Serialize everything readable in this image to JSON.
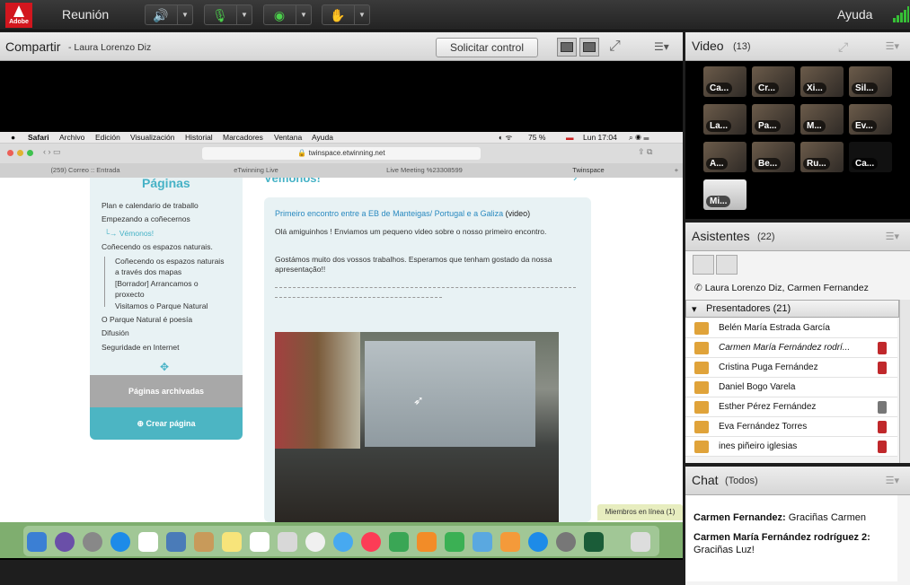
{
  "topbar": {
    "logo": "Adobe",
    "meeting_menu": "Reunión",
    "help": "Ayuda"
  },
  "share": {
    "title": "Compartir",
    "presenter": "- Laura Lorenzo Diz",
    "request_control": "Solicitar control"
  },
  "mac": {
    "app": "Safari",
    "menus": [
      "Archivo",
      "Edición",
      "Visualización",
      "Historial",
      "Marcadores",
      "Ventana",
      "Ayuda"
    ],
    "battery": "75 %",
    "clock": "Lun 17:04",
    "url": "twinspace.etwinning.net",
    "tabs": [
      "(259) Correo :: Entrada",
      "eTwinning Live",
      "Live Meeting %23308599",
      "Twinspace"
    ]
  },
  "webpage": {
    "sidebar_title": "Páginas",
    "nav": [
      "Plan e calendario de traballo",
      "Empezando a coñecernos",
      "└→ Vémonos!",
      "Coñecendo os espazos naturais.",
      "Coñecendo os espazos naturais",
      "a través dos mapas",
      "[Borrador] Arrancamos o",
      "proxecto",
      "Visitamos o Parque Natural",
      "O Parque Natural é poesía",
      "Difusión",
      "Seguridade en Internet"
    ],
    "archived": "Páginas archivadas",
    "create": "Crear página",
    "heading": "Vémonos!",
    "post_title": "Primeiro encontro entre a EB de Manteigas/ Portugal e a Galiza",
    "post_tag": "(video)",
    "p1": "Olá amiguinhos ! Enviamos um pequeno video sobre o nosso primeiro encontro.",
    "p2": "Gostámos muito dos vossos trabalhos. Esperamos que tenham gostado da nossa apresentação!!",
    "members_online": "Miembros en línea (1)"
  },
  "video": {
    "title": "Video",
    "count": "(13)",
    "tiles": [
      "Ca...",
      "Cr...",
      "Xi...",
      "Sil...",
      "La...",
      "Pa...",
      "M...",
      "Ev...",
      "A...",
      "Be...",
      "Ru...",
      "Ca...",
      "Mi..."
    ]
  },
  "attendees": {
    "title": "Asistentes",
    "count": "(22)",
    "hosts": "Laura Lorenzo Diz, Carmen Fernandez",
    "presenters_header": "Presentadores (21)",
    "list": [
      "Belén María Estrada García",
      "Carmen María Fernández rodrí...",
      "Cristina Puga Fernández",
      "Daniel Bogo Varela",
      "Esther Pérez Fernández",
      "Eva Fernández Torres",
      "ines piñeiro iglesias"
    ]
  },
  "chat": {
    "title": "Chat",
    "scope": "(Todos)",
    "messages": [
      {
        "from": "Carmen Fernandez:",
        "text": "Graciñas Carmen"
      },
      {
        "from": "Carmen María Fernández rodríguez 2:",
        "text": "Graciñas Luz!"
      }
    ]
  },
  "colors": {
    "accent": "#46b2c6",
    "adobe_red": "#d2161e",
    "active_green": "#4bd14b"
  }
}
